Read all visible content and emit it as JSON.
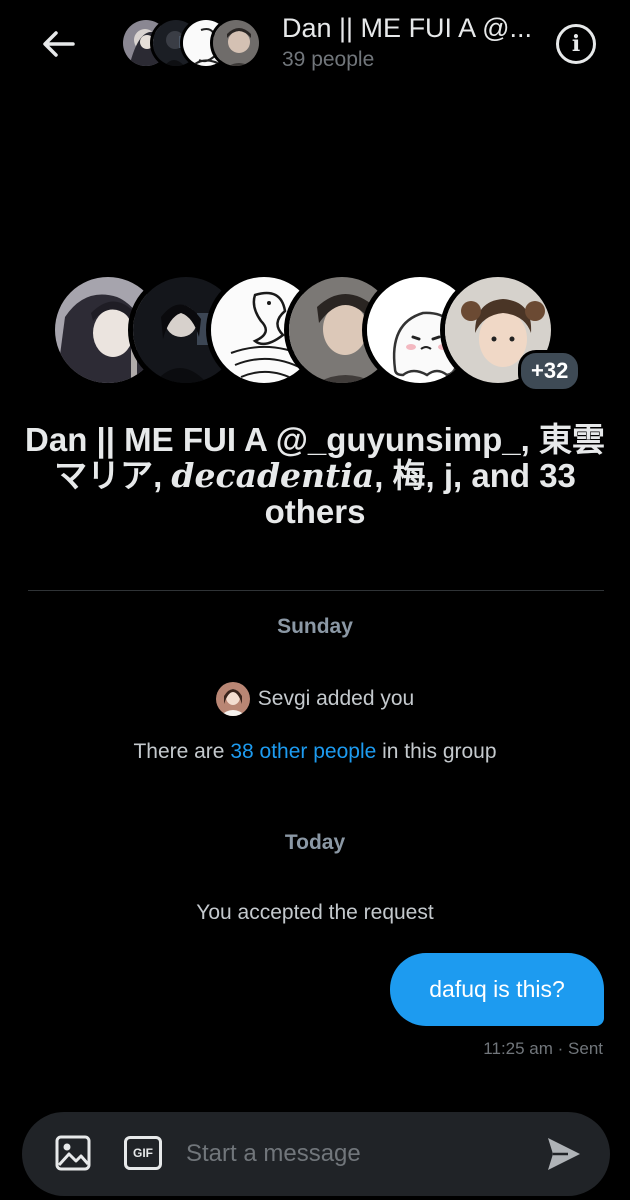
{
  "header": {
    "title": "Dan || ME FUI A @...",
    "subtitle": "39 people",
    "back_icon": "arrow-left-icon",
    "info_icon": "info-icon",
    "info_glyph": "i"
  },
  "group": {
    "more_badge": "+32",
    "title_part1": "Dan || ME FUI A @_guyunsimp_, 東雲マリア, ",
    "title_fancy": "decadentia",
    "title_part2": ", 梅, j, and 33 others"
  },
  "timeline": {
    "sunday_label": "Sunday",
    "added_text": "Sevgi added you",
    "there_are": "There are ",
    "others_link": "38 other people",
    "in_group": " in this group",
    "today_label": "Today",
    "accepted_text": "You accepted the request"
  },
  "message": {
    "text": "dafuq is this?",
    "meta": "11:25 am · Sent"
  },
  "composer": {
    "placeholder": "Start a message",
    "gif_label": "GIF",
    "image_icon": "image-icon",
    "send_icon": "send-icon"
  },
  "colors": {
    "accent": "#1d9bf0",
    "background": "#000000",
    "composer": "#202327"
  }
}
